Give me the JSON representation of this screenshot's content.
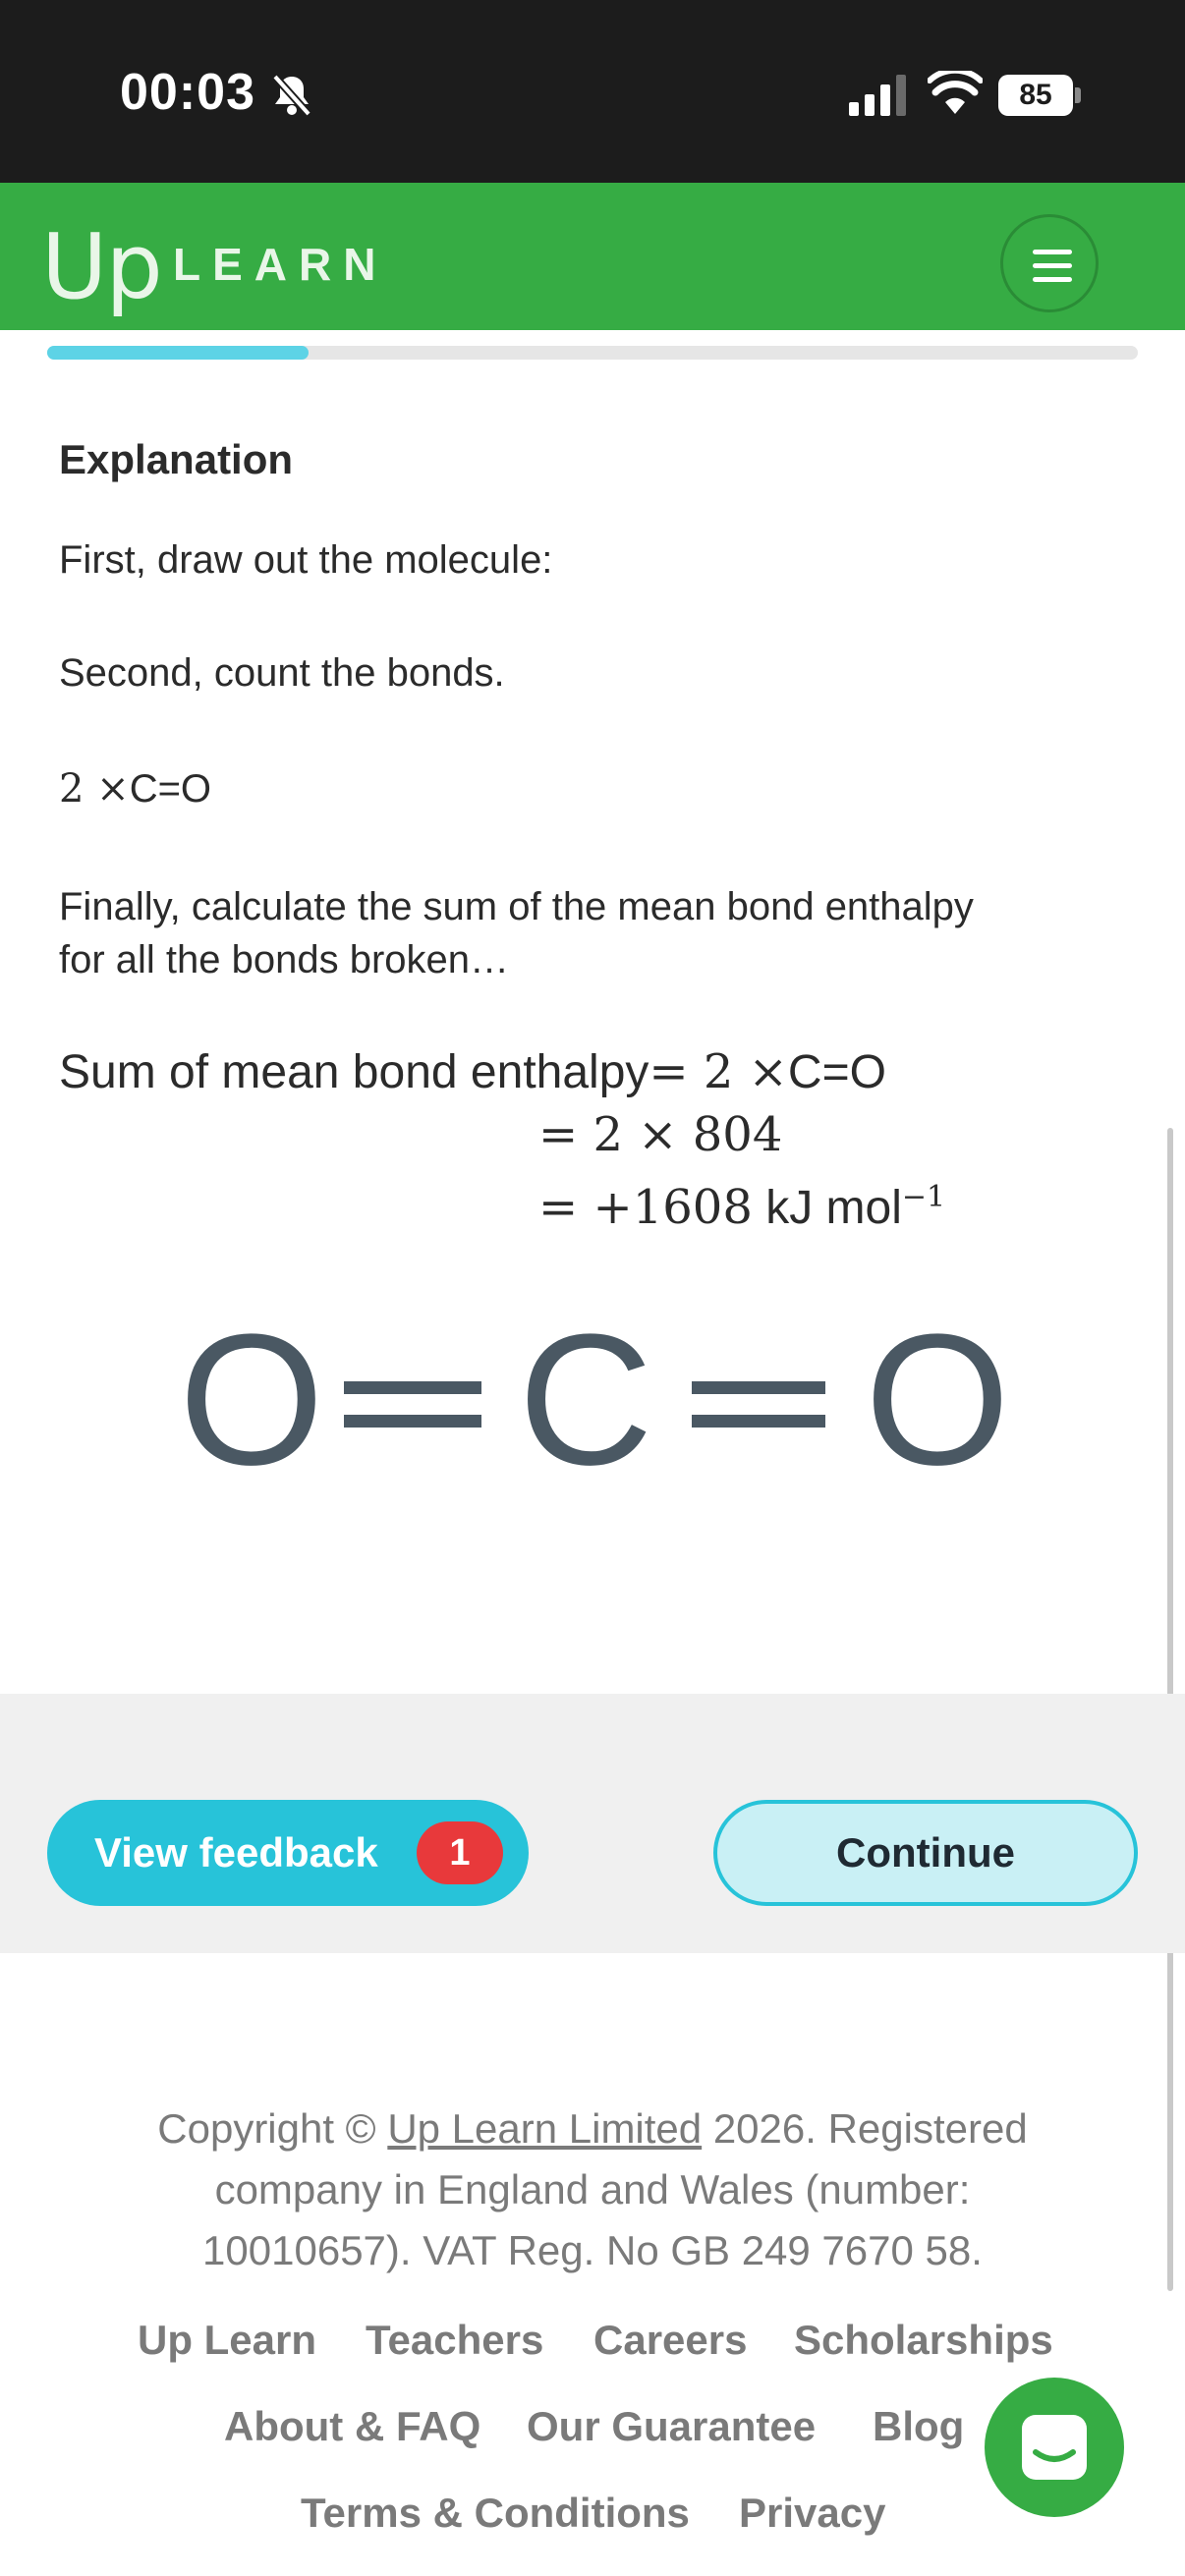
{
  "status_bar": {
    "time": "00:03",
    "battery": "85"
  },
  "header": {
    "logo_up": "Up",
    "logo_learn": "LEARN"
  },
  "progress": {
    "fraction": 0.24
  },
  "content": {
    "heading": "Explanation",
    "line1": "First, draw out the molecule:",
    "line2": "Second, count the bonds.",
    "bond_count_num": "2 ×",
    "bond_count_bond": "C=O",
    "line3a": "Finally, calculate the sum of the mean bond enthalpy",
    "line3b": "for all the bonds broken…",
    "sum_label": "Sum of mean bond enthalpy",
    "sum_eq1_math": "= 2 ×",
    "sum_eq1_bond": "C=O",
    "sum_eq2": "= 2 × 804",
    "sum_eq3_math": "= +1608",
    "sum_eq3_unit": "kJ mol",
    "sum_eq3_exp": "−1",
    "molecule_atoms": [
      "O",
      "C",
      "O"
    ]
  },
  "actions": {
    "feedback_label": "View feedback",
    "feedback_count": "1",
    "continue_label": "Continue"
  },
  "footer": {
    "copyright_prefix": "Copyright ©",
    "company_link": "Up Learn Limited",
    "copyright_line1_suffix": "2026. Registered",
    "copyright_line2": "company in England and Wales (number:",
    "copyright_line3": "10010657). VAT Reg. No GB 249 7670 58.",
    "links_row1": [
      "Up Learn",
      "Teachers",
      "Careers",
      "Scholarships"
    ],
    "links_row2": [
      "About & FAQ",
      "Our Guarantee",
      "Blog"
    ],
    "links_row3": [
      "Terms & Conditions",
      "Privacy"
    ]
  },
  "colors": {
    "brand_green": "#36ac44",
    "accent_cyan": "#27c3d9",
    "badge_red": "#e8393b",
    "status_bar": "#1c1c1c"
  }
}
